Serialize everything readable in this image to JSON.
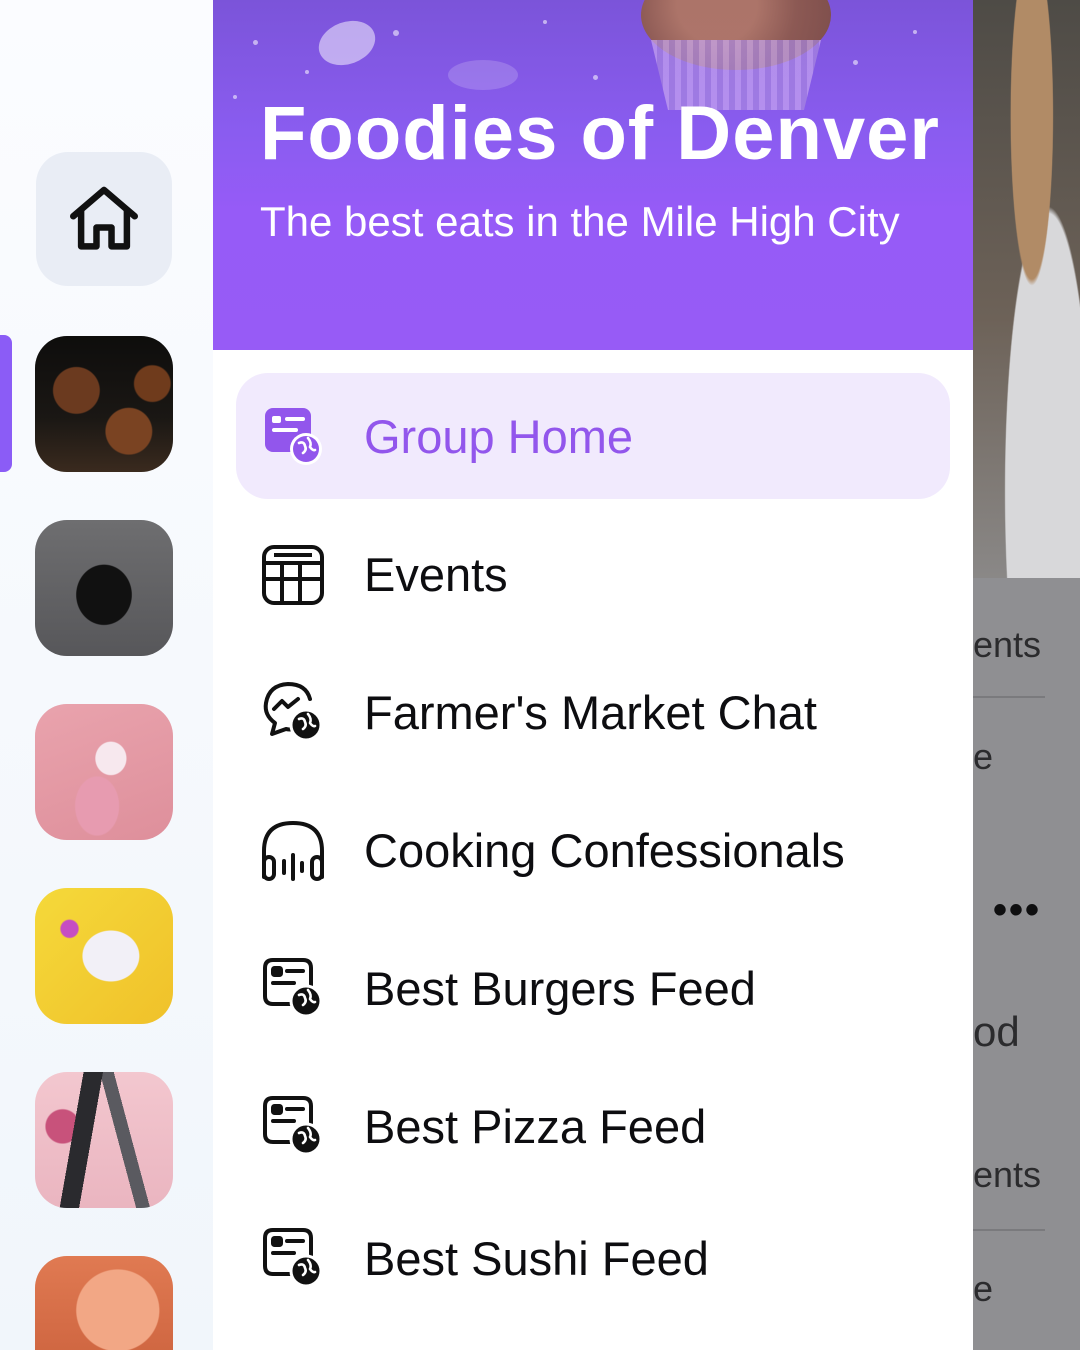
{
  "header": {
    "title": "Foodies of Denver",
    "subtitle": "The best eats in the Mile High City"
  },
  "menu": {
    "items": [
      {
        "label": "Group Home",
        "icon": "feed-globe-icon",
        "active": true
      },
      {
        "label": "Events",
        "icon": "calendar-icon",
        "active": false
      },
      {
        "label": "Farmer's Market Chat",
        "icon": "chat-globe-icon",
        "active": false
      },
      {
        "label": "Cooking Confessionals",
        "icon": "headphones-audio-icon",
        "active": false
      },
      {
        "label": "Best Burgers Feed",
        "icon": "feed-globe-icon",
        "active": false
      },
      {
        "label": "Best Pizza Feed",
        "icon": "feed-globe-icon",
        "active": false
      },
      {
        "label": "Best Sushi Feed",
        "icon": "feed-globe-icon",
        "active": false
      }
    ]
  },
  "rail": {
    "home_icon": "home-icon",
    "groups": [
      {
        "name": "muffins-group",
        "selected": true
      },
      {
        "name": "dog-group",
        "selected": false
      },
      {
        "name": "roller-skates-group",
        "selected": false
      },
      {
        "name": "gaming-group",
        "selected": false
      },
      {
        "name": "hair-tools-group",
        "selected": false
      },
      {
        "name": "food-group",
        "selected": false
      }
    ]
  },
  "background_app": {
    "fragments": [
      "ents",
      "e",
      "od",
      "ents",
      "e"
    ]
  },
  "colors": {
    "accent": "#8b5cf6",
    "active_bg": "#f1eafd",
    "active_text": "#9256ec",
    "header_purple": "#965bf7"
  }
}
